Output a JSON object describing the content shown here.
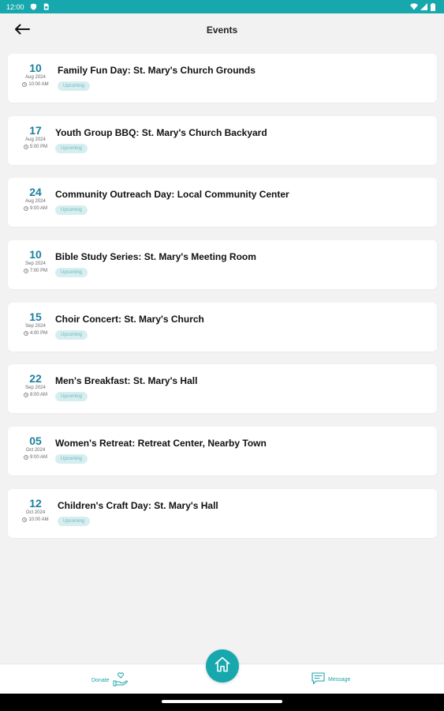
{
  "status_bar": {
    "time": "12:00"
  },
  "app_bar": {
    "title": "Events"
  },
  "events": [
    {
      "day": "10",
      "month": "Aug 2024",
      "time": "10:00 AM",
      "title": "Family Fun Day: St. Mary's Church Grounds",
      "status": "Upcoming"
    },
    {
      "day": "17",
      "month": "Aug 2024",
      "time": "5:00 PM",
      "title": "Youth Group BBQ: St. Mary's Church Backyard",
      "status": "Upcoming"
    },
    {
      "day": "24",
      "month": "Aug 2024",
      "time": "9:00 AM",
      "title": "Community Outreach Day: Local Community Center",
      "status": "Upcoming"
    },
    {
      "day": "10",
      "month": "Sep 2024",
      "time": "7:00 PM",
      "title": "Bible Study Series: St. Mary's Meeting Room",
      "status": "Upcoming"
    },
    {
      "day": "15",
      "month": "Sep 2024",
      "time": "4:00 PM",
      "title": "Choir Concert: St. Mary's Church",
      "status": "Upcoming"
    },
    {
      "day": "22",
      "month": "Sep 2024",
      "time": "8:00 AM",
      "title": "Men's Breakfast: St. Mary's Hall",
      "status": "Upcoming"
    },
    {
      "day": "05",
      "month": "Oct 2024",
      "time": "9:00 AM",
      "title": "Women's Retreat: Retreat Center, Nearby Town",
      "status": "Upcoming"
    },
    {
      "day": "12",
      "month": "Oct 2024",
      "time": "10:00 AM",
      "title": "Children's Craft Day: St. Mary's Hall",
      "status": "Upcoming"
    }
  ],
  "bottom_nav": {
    "donate_label": "Donate",
    "message_label": "Message",
    "home_icon": "home-icon"
  },
  "colors": {
    "accent": "#17a8ad",
    "date": "#1c7f9d",
    "badge_bg": "#d7eef0",
    "badge_text": "#6cb9bf",
    "background": "#f2f2f2"
  }
}
